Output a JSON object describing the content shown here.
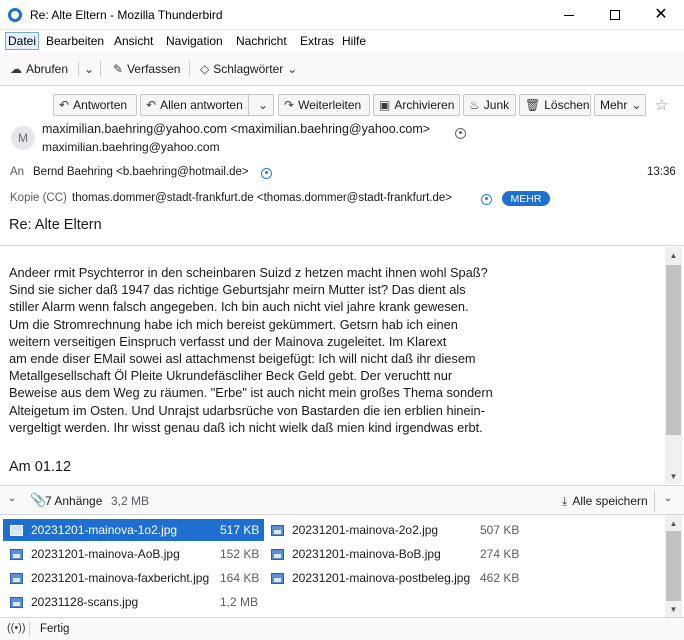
{
  "window": {
    "title": "Re: Alte Eltern - Mozilla Thunderbird"
  },
  "menu": {
    "items": [
      "Datei",
      "Bearbeiten",
      "Ansicht",
      "Navigation",
      "Nachricht",
      "Extras",
      "Hilfe"
    ]
  },
  "toolbar": {
    "fetch_label": "Abrufen",
    "compose_label": "Verfassen",
    "tags_label": "Schlagwörter"
  },
  "header_buttons": {
    "reply": "Antworten",
    "reply_all": "Allen antworten",
    "forward": "Weiterleiten",
    "archive": "Archivieren",
    "junk": "Junk",
    "delete": "Löschen",
    "more": "Mehr"
  },
  "message": {
    "avatar_letter": "M",
    "from": "maximilian.baehring@yahoo.com <maximilian.baehring@yahoo.com>",
    "from_sub": "maximilian.baehring@yahoo.com",
    "to_label": "An",
    "to": "Bernd Baehring <b.baehring@hotmail.de>",
    "time": "13:36",
    "cc_label": "Kopie (CC)",
    "cc": "thomas.dommer@stadt-frankfurt.de <thomas.dommer@stadt-frankfurt.de>",
    "more_badge": "MEHR",
    "subject": "Re: Alte Eltern",
    "body_lines": [
      "Andeer rmit Psychterror in den scheinbaren Suizd z hetzen macht ihnen wohl Spaß?",
      "Sind sie sicher daß 1947 das richtige Geburtsjahr meirn Mutter ist? Das dient als",
      "stiller Alarm wenn falsch angegeben. Ich bin auch nicht viel jahre krank gewesen.",
      "Um die Stromrechnung habe ich mich bereist gekümmert. Getsrn hab ich einen",
      "weitern verseitigen Einspruch verfasst und der Mainova zugeleitet. Im Klarext",
      "am ende diser EMail sowei asl attachmenst beigefügt: Ich will nicht daß ihr diesem",
      "Metallgesellschaft Öl Pleite Ukrundefäscliher Beck Geld gebt. Der veruchtt nur",
      "Beweise aus dem Weg zu räumen. \"Erbe\" ist auch nicht mein großes Thema sondern",
      "Alteigetum im Osten. Und Unrajst udarbsrüche von Bastarden die ien erblien hinein-",
      "vergeltigt werden. Ihr wisst genau daß ich nicht wielk daß mien kind irgendwas erbt."
    ],
    "date_line": "Am 01.12"
  },
  "attachments": {
    "summary": "7 Anhänge",
    "total_size": "3,2 MB",
    "save_all": "Alle speichern",
    "items": [
      {
        "name": "20231201-mainova-1o2.jpg",
        "size": "517 KB"
      },
      {
        "name": "20231201-mainova-2o2.jpg",
        "size": "507 KB"
      },
      {
        "name": "20231201-mainova-AoB.jpg",
        "size": "152 KB"
      },
      {
        "name": "20231201-mainova-BoB.jpg",
        "size": "274 KB"
      },
      {
        "name": "20231201-mainova-faxbericht.jpg",
        "size": "164 KB"
      },
      {
        "name": "20231201-mainova-postbeleg.jpg",
        "size": "462 KB"
      },
      {
        "name": "20231128-scans.jpg",
        "size": "1,2 MB"
      }
    ]
  },
  "status": {
    "text": "Fertig"
  },
  "colors": {
    "accent": "#1f6fd1"
  }
}
